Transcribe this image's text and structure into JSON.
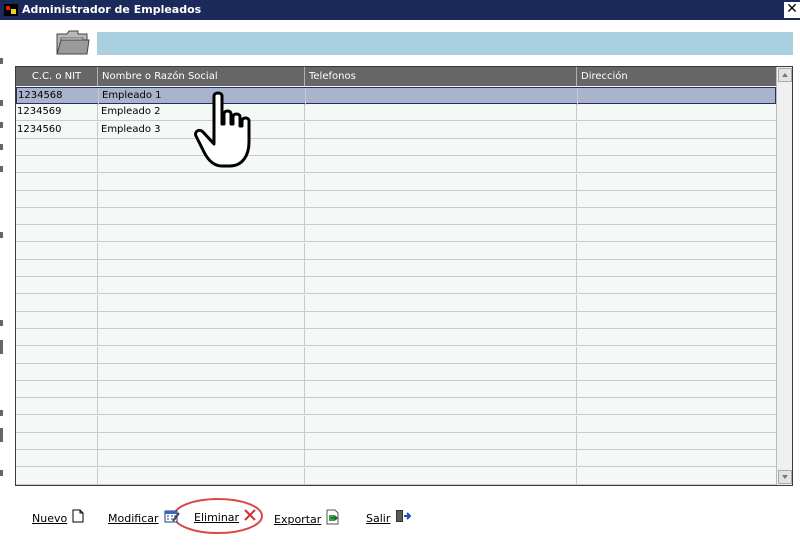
{
  "window": {
    "title": "Administrador de Empleados",
    "close_glyph": "✕"
  },
  "header": {
    "folder_icon": "folder-icon",
    "bar_color": "#aacfe0"
  },
  "grid": {
    "columns": [
      "C.C. o NIT",
      "Nombre o Razón Social",
      "Telefonos",
      "Dirección"
    ],
    "rows": [
      [
        "1234568",
        "Empleado 1",
        "",
        ""
      ],
      [
        "1234569",
        "Empleado 2",
        "",
        ""
      ],
      [
        "1234560",
        "Empleado 3",
        "",
        ""
      ]
    ],
    "selected_row": 0,
    "header_color": "#666666",
    "selected_color": "#a9b3cc"
  },
  "toolbar": {
    "buttons": [
      {
        "label": "Nuevo",
        "icon": "new-document-icon"
      },
      {
        "label": "Modificar",
        "icon": "edit-calendar-icon"
      },
      {
        "label": "Eliminar",
        "icon": "delete-x-icon"
      },
      {
        "label": "Exportar",
        "icon": "export-icon"
      },
      {
        "label": "Salir",
        "icon": "exit-door-icon"
      }
    ],
    "highlighted": "Eliminar"
  },
  "cursor": "hand-pointer-icon"
}
